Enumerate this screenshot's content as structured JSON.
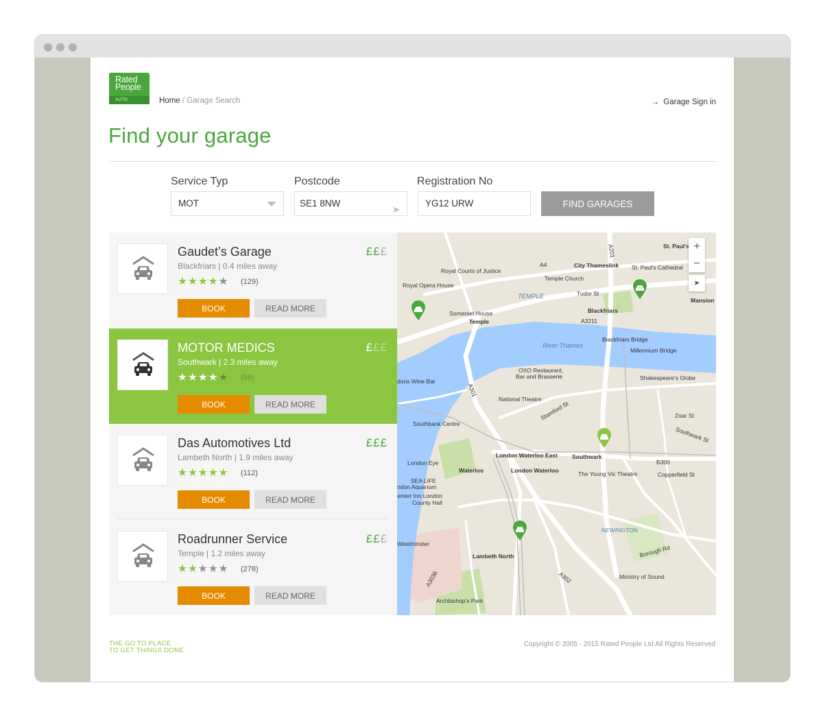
{
  "logo": {
    "line1": "Rated",
    "line2": "People",
    "tag": "AUTO"
  },
  "breadcrumb": {
    "home": "Home",
    "separator": " / ",
    "current": "Garage Search"
  },
  "signin": {
    "label": "Garage Sign in"
  },
  "page_title": "Find your garage",
  "search": {
    "service_label": "Service Typ",
    "service_value": "MOT",
    "postcode_label": "Postcode",
    "postcode_value": "SE1 8NW",
    "reg_label": "Registration No",
    "reg_value": "YG12 URW",
    "button": "FIND GARAGES"
  },
  "garages": [
    {
      "name": "Gaudet’s Garage",
      "area": "Blackfriars",
      "distance": "0.4 miles away",
      "rating": 4,
      "reviews": "(129)",
      "price_level": 2,
      "active": false
    },
    {
      "name": "MOTOR MEDICS",
      "area": "Southwark",
      "distance": "2.3 miles away",
      "rating": 4,
      "reviews": "(88)",
      "price_level": 1,
      "active": true
    },
    {
      "name": "Das Automotives Ltd",
      "area": "Lambeth North",
      "distance": "1.9 miles away",
      "rating": 5,
      "reviews": "(112)",
      "price_level": 3,
      "active": false
    },
    {
      "name": "Roadrunner Service",
      "area": "Temple",
      "distance": "1.2 miles away",
      "rating": 2,
      "reviews": "(278)",
      "price_level": 2,
      "active": false
    }
  ],
  "buttons": {
    "book": "BOOK",
    "read_more": "READ MORE"
  },
  "map": {
    "labels": [
      "St. Paul's",
      "City Thameslink",
      "St. Paul's Cathedral",
      "Royal Courts of Justice",
      "Temple Church",
      "Royal Opera House",
      "TEMPLE",
      "Tudor St",
      "Mansion House",
      "Blackfriars",
      "Somerset House",
      "Temple",
      "A3211",
      "River Thames",
      "Blackfriars Bridge",
      "Millennium Bridge",
      "OXO Restaurant,",
      "Bar and Brasserie",
      "Shakespeare's Globe",
      "dons Wine Bar",
      "National Theatre",
      "Stamford St",
      "Southbank Centre",
      "Southwark St",
      "London Waterloo East",
      "Southwark",
      "B300",
      "London Eye",
      "Waterloo",
      "London Waterloo",
      "The Young Vic Theatre",
      "Copperfield St",
      "SEA LIFE",
      "ndon Aquarium",
      "emier Inn London",
      "County Hall",
      "NEWINGTON",
      "Borough Rd",
      "Lambeth North",
      "Westminster",
      "Ministry of Sound",
      "Archbishop's Park",
      "A302",
      "A301",
      "A4",
      "A201",
      "A3036",
      "Zoar St"
    ],
    "zoom_in": "+",
    "zoom_out": "−",
    "pins": 5,
    "colors": {
      "water": "#a3ccff",
      "road": "#ffffff",
      "land": "#eae6dc",
      "park": "#c8dfa8",
      "pin": "#4aa73c"
    }
  },
  "footer": {
    "tagline_1": "THE GO TO PLACE",
    "tagline_2": "TO GET THINGS DONE",
    "copyright": "Copyright © 2005 - 2015 Rated People Ltd All Rights Reserved"
  },
  "colors": {
    "brand_green": "#4aa73c",
    "active_green": "#8cc641",
    "book_orange": "#e68a00"
  }
}
